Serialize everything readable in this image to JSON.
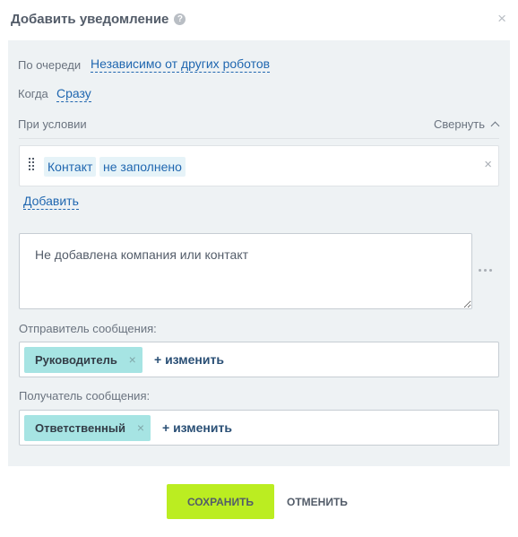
{
  "dialog": {
    "title": "Добавить уведомление",
    "help_glyph": "?",
    "close_glyph": "×"
  },
  "queue": {
    "label": "По очереди",
    "value": "Независимо от других роботов"
  },
  "when": {
    "label": "Когда",
    "value": "Сразу"
  },
  "condition": {
    "label": "При условии",
    "collapse_label": "Свернуть",
    "field": "Контакт",
    "operator": "не заполнено",
    "remove_glyph": "×",
    "add_label": "Добавить"
  },
  "message": {
    "text": "Не добавлена компания или контакт"
  },
  "sender": {
    "label": "Отправитель сообщения:",
    "tag": "Руководитель",
    "change_label": "+ изменить"
  },
  "recipient": {
    "label": "Получатель сообщения:",
    "tag": "Ответственный",
    "change_label": "+ изменить"
  },
  "footer": {
    "save_label": "СОХРАНИТЬ",
    "cancel_label": "ОТМЕНИТЬ"
  },
  "colors": {
    "accent_green": "#bbed21",
    "link_blue": "#2067b0",
    "tag_teal": "#a6e4e3",
    "panel_bg": "#eef2f4"
  }
}
